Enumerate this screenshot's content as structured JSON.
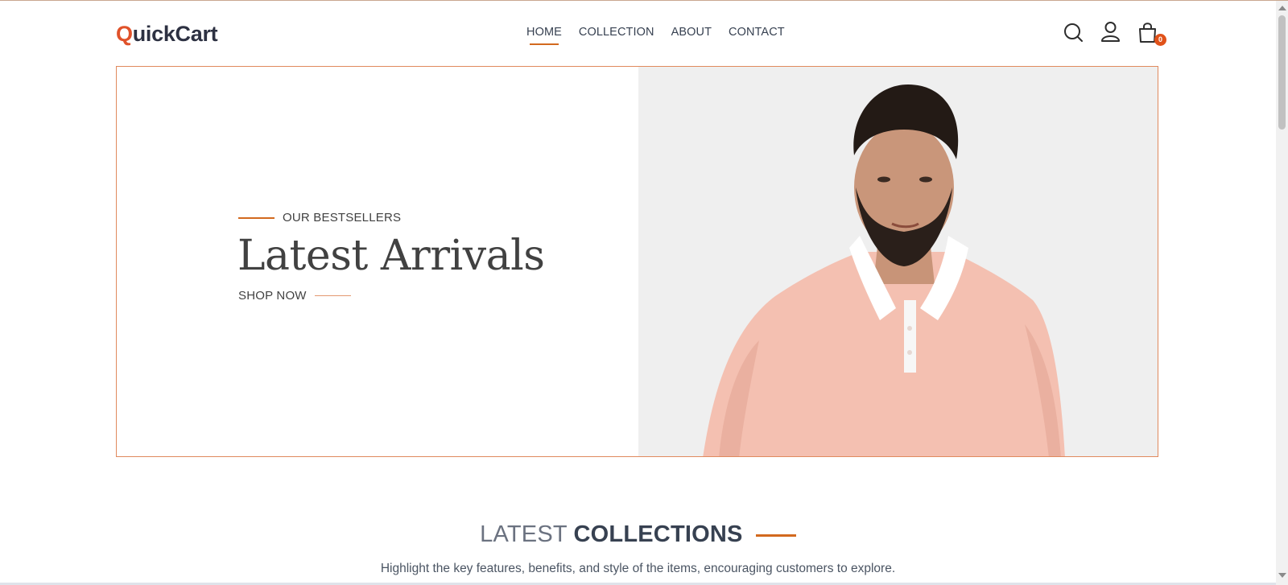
{
  "header": {
    "logo_first": "Q",
    "logo_rest": "uickCart",
    "nav": [
      {
        "label": "HOME",
        "active": true
      },
      {
        "label": "COLLECTION",
        "active": false
      },
      {
        "label": "ABOUT",
        "active": false
      },
      {
        "label": "CONTACT",
        "active": false
      }
    ],
    "icons": [
      "search-icon",
      "user-icon",
      "cart-icon"
    ],
    "cart_count": "0"
  },
  "hero": {
    "eyebrow": "OUR BESTSELLERS",
    "title": "Latest Arrivals",
    "cta": "SHOP NOW"
  },
  "collections": {
    "title_light": "LATEST",
    "title_bold": "COLLECTIONS",
    "description": "Highlight the key features, benefits, and style of the items, encouraging customers to explore."
  },
  "colors": {
    "accent": "#d2691e",
    "logo_q": "#e0522a",
    "text_dark": "#374151",
    "hero_bg": "#efefef",
    "shirt": "#f4c0b1"
  }
}
